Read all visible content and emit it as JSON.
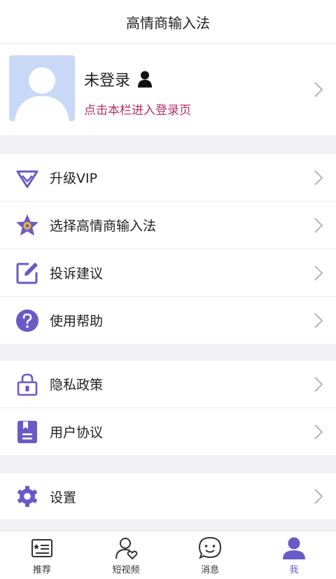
{
  "header": {
    "title": "高情商输入法"
  },
  "profile": {
    "name": "未登录",
    "hint": "点击本栏进入登录页"
  },
  "sections": [
    {
      "items": [
        {
          "label": "升级VIP",
          "icon": "diamond-icon"
        },
        {
          "label": "选择高情商输入法",
          "icon": "star-icon"
        },
        {
          "label": "投诉建议",
          "icon": "edit-icon"
        },
        {
          "label": "使用帮助",
          "icon": "help-icon"
        }
      ]
    },
    {
      "items": [
        {
          "label": "隐私政策",
          "icon": "lock-icon"
        },
        {
          "label": "用户协议",
          "icon": "document-icon"
        }
      ]
    },
    {
      "items": [
        {
          "label": "设置",
          "icon": "gear-icon"
        }
      ]
    }
  ],
  "tabs": [
    {
      "label": "推荐",
      "icon": "list-icon"
    },
    {
      "label": "短视频",
      "icon": "user-heart-icon"
    },
    {
      "label": "消息",
      "icon": "message-icon"
    },
    {
      "label": "我",
      "icon": "profile-icon",
      "active": true
    }
  ],
  "colors": {
    "accent": "#6a5ac6",
    "hint": "#b62f6a",
    "star": "#e6b23c"
  }
}
